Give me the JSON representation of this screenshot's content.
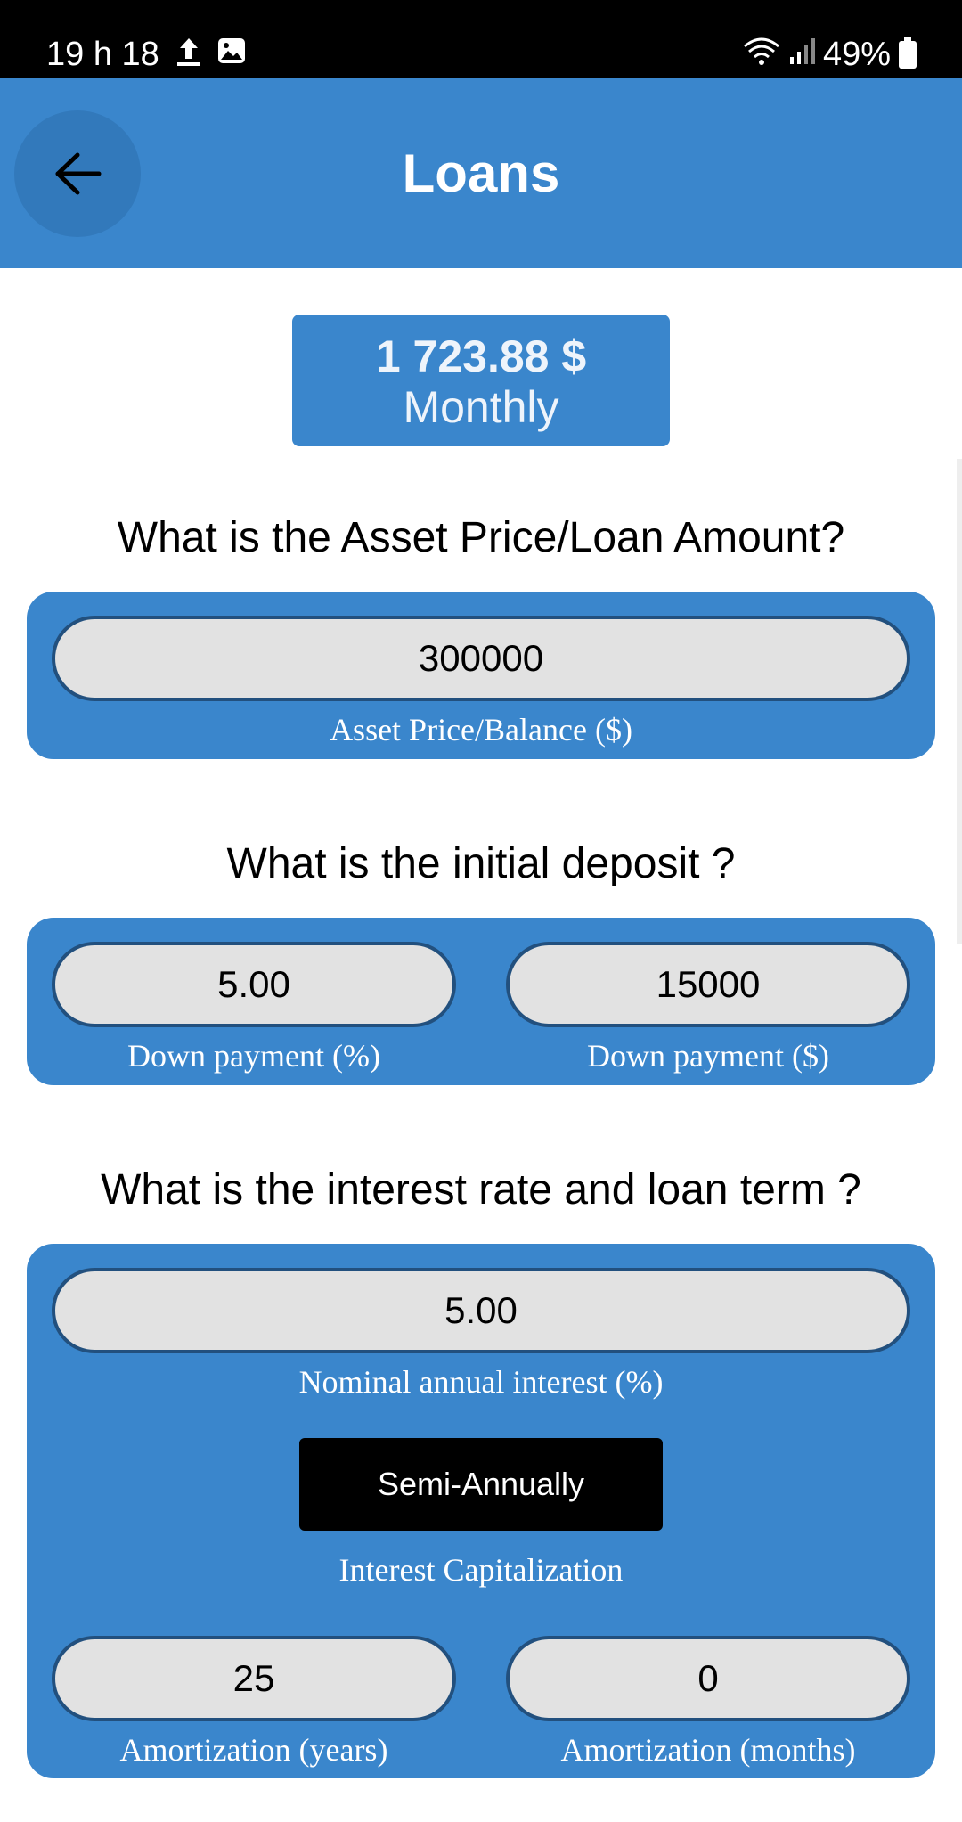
{
  "status_bar": {
    "time": "19 h 18",
    "battery": "49%",
    "icons": [
      "upload-icon",
      "image-icon",
      "wifi-icon",
      "signal-icon",
      "battery-icon"
    ]
  },
  "app_bar": {
    "title": "Loans",
    "back_icon": "arrow-left-icon"
  },
  "result": {
    "amount": "1 723.88 $",
    "period": "Monthly"
  },
  "sections": {
    "loan_amount": {
      "question": "What is the Asset Price/Loan Amount?",
      "value": "300000",
      "label": "Asset Price/Balance ($)"
    },
    "deposit": {
      "question": "What is the initial deposit ?",
      "percent_value": "5.00",
      "percent_label": "Down payment (%)",
      "amount_value": "15000",
      "amount_label": "Down payment ($)"
    },
    "interest": {
      "question": "What is the interest rate and loan term ?",
      "rate_value": "5.00",
      "rate_label": "Nominal annual interest (%)",
      "capitalization_value": "Semi-Annually",
      "capitalization_label": "Interest Capitalization",
      "years_value": "25",
      "years_label": "Amortization (years)",
      "months_value": "0",
      "months_label": "Amortization (months)"
    }
  },
  "colors": {
    "primary": "#3a86cc",
    "field_bg": "#e2e2e2",
    "field_border": "#22507e"
  }
}
